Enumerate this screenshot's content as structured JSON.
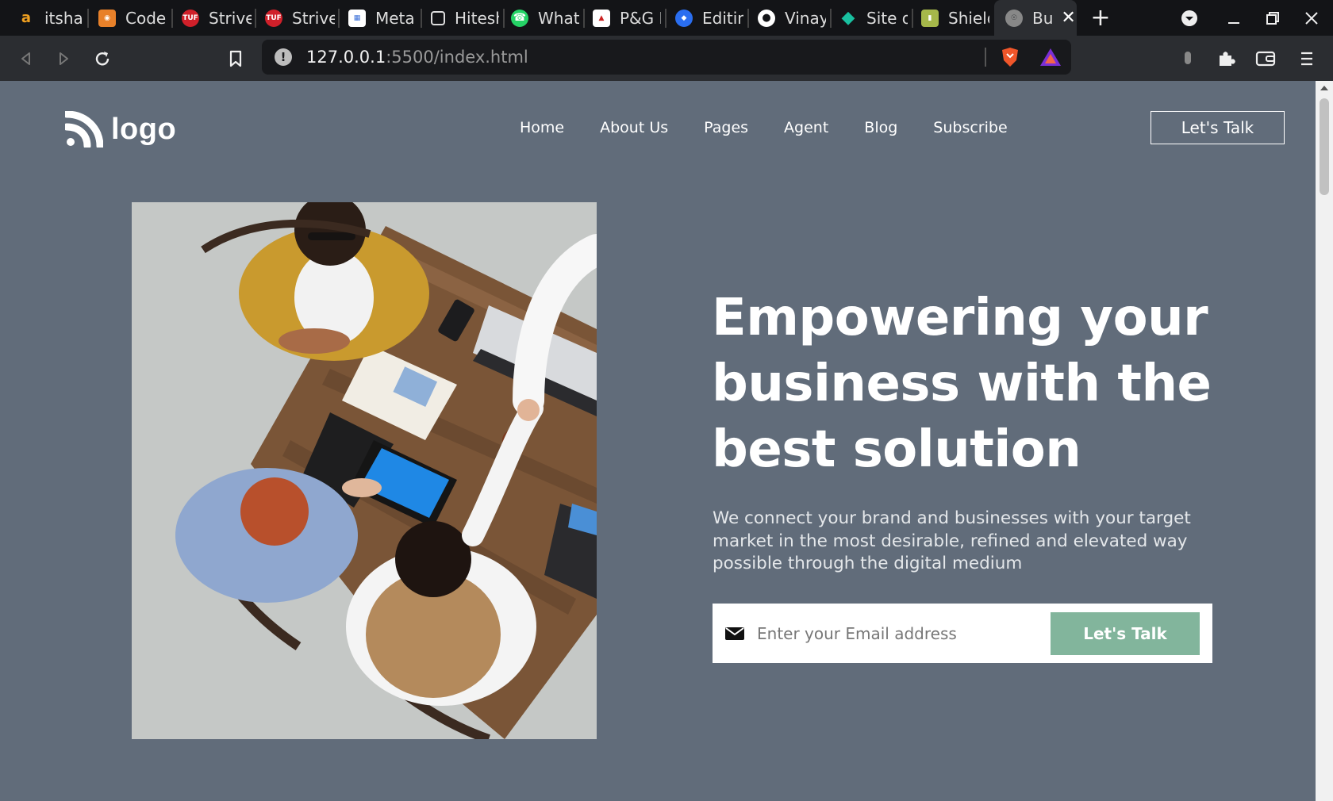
{
  "browser": {
    "tabs": [
      {
        "title": "itshar",
        "icon": "amazon-icon"
      },
      {
        "title": "Code",
        "icon": "codechef-icon"
      },
      {
        "title": "Strive",
        "icon": "tuf-icon"
      },
      {
        "title": "Strive",
        "icon": "tuf-icon"
      },
      {
        "title": "Meta",
        "icon": "meta-doc-icon"
      },
      {
        "title": "Hitesh",
        "icon": "square-icon"
      },
      {
        "title": "What",
        "icon": "whatsapp-icon"
      },
      {
        "title": "P&G F",
        "icon": "pg-icon"
      },
      {
        "title": "Editin",
        "icon": "editing-icon"
      },
      {
        "title": "Vinay",
        "icon": "github-icon"
      },
      {
        "title": "Site o",
        "icon": "diamond-icon"
      },
      {
        "title": "Shield",
        "icon": "shield-app-icon"
      }
    ],
    "active_tab": {
      "title": "Bu",
      "icon": "globe-icon"
    },
    "url_host": "127.0.0.1",
    "url_path": ":5500/index.html"
  },
  "page": {
    "logo_text": "logo",
    "nav": [
      "Home",
      "About Us",
      "Pages",
      "Agent",
      "Blog",
      "Subscribe"
    ],
    "header_cta": "Let's Talk",
    "headline_lines": [
      "Empowering your",
      "business with the",
      "best solution"
    ],
    "subtext": "We connect your brand and businesses with your target market in the most desirable, refined and elevated way possible through the digital medium",
    "email_placeholder": "Enter your Email address",
    "submit_label": "Let's Talk"
  },
  "colors": {
    "page_bg": "#616c7a",
    "accent_button": "#82b59c",
    "chrome_dark": "#131417"
  }
}
